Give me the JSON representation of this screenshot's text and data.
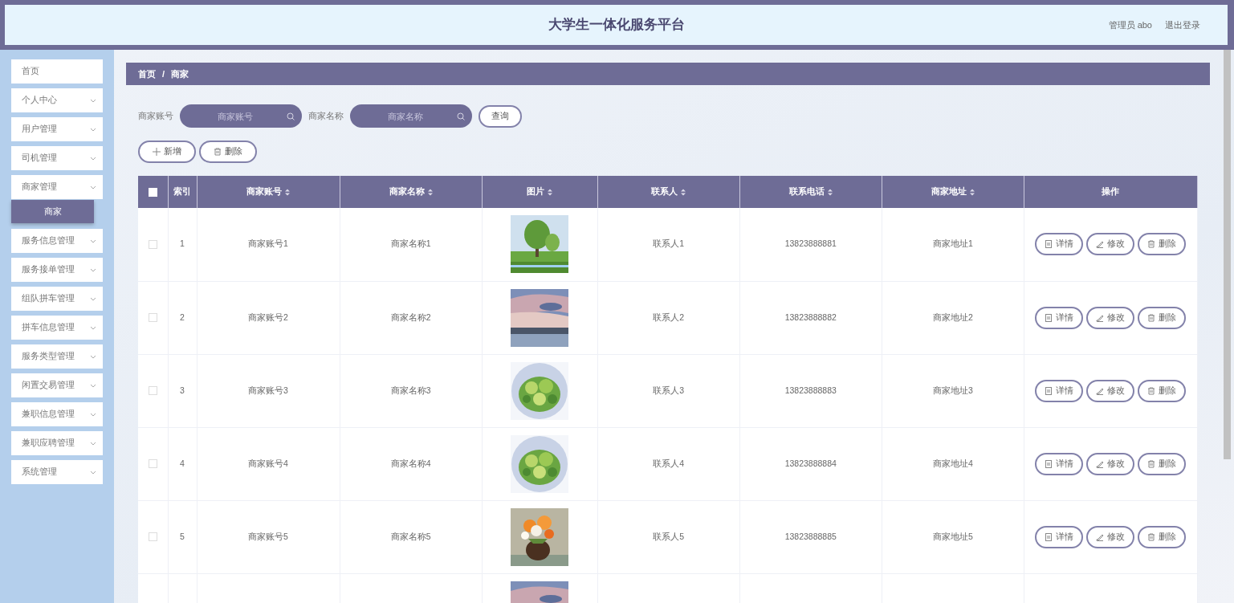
{
  "header": {
    "title": "大学生一体化服务平台",
    "user": "管理员 abo",
    "logout": "退出登录"
  },
  "sidebar": {
    "items": [
      {
        "label": "首页",
        "has_children": false
      },
      {
        "label": "个人中心",
        "has_children": true
      },
      {
        "label": "用户管理",
        "has_children": true
      },
      {
        "label": "司机管理",
        "has_children": true
      },
      {
        "label": "商家管理",
        "has_children": true,
        "children": [
          {
            "label": "商家",
            "selected": true
          }
        ]
      },
      {
        "label": "服务信息管理",
        "has_children": true
      },
      {
        "label": "服务接单管理",
        "has_children": true
      },
      {
        "label": "组队拼车管理",
        "has_children": true
      },
      {
        "label": "拼车信息管理",
        "has_children": true
      },
      {
        "label": "服务类型管理",
        "has_children": true
      },
      {
        "label": "闲置交易管理",
        "has_children": true
      },
      {
        "label": "兼职信息管理",
        "has_children": true
      },
      {
        "label": "兼职应聘管理",
        "has_children": true
      },
      {
        "label": "系统管理",
        "has_children": true
      }
    ]
  },
  "breadcrumb": [
    "首页",
    "商家"
  ],
  "breadcrumb_separator": "/",
  "search": {
    "fields": [
      {
        "label": "商家账号",
        "placeholder": "商家账号"
      },
      {
        "label": "商家名称",
        "placeholder": "商家名称"
      }
    ],
    "button": "查询"
  },
  "actions": [
    {
      "kind": "add",
      "label": "新增"
    },
    {
      "kind": "delete",
      "label": "删除"
    }
  ],
  "table": {
    "columns": [
      {
        "label": "索引",
        "sortable": false
      },
      {
        "label": "商家账号",
        "sortable": true
      },
      {
        "label": "商家名称",
        "sortable": true
      },
      {
        "label": "图片",
        "sortable": true
      },
      {
        "label": "联系人",
        "sortable": true
      },
      {
        "label": "联系电话",
        "sortable": true
      },
      {
        "label": "商家地址",
        "sortable": true
      },
      {
        "label": "操作",
        "sortable": false
      }
    ],
    "header_checked": false,
    "rows": [
      {
        "checked": false,
        "index": "1",
        "account": "商家账号1",
        "name": "商家名称1",
        "image": {
          "kind": "picture"
        },
        "contact": "联系人1",
        "phone": "13823888881",
        "address": "商家地址1",
        "actions": [
          {
            "kind": "detail",
            "label": "详情"
          },
          {
            "kind": "edit",
            "label": "修改"
          },
          {
            "kind": "delete",
            "label": "删除"
          }
        ]
      },
      {
        "checked": false,
        "index": "2",
        "account": "商家账号2",
        "name": "商家名称2",
        "image": {
          "kind": "picture"
        },
        "contact": "联系人2",
        "phone": "13823888882",
        "address": "商家地址2",
        "actions": [
          {
            "kind": "detail",
            "label": "详情"
          },
          {
            "kind": "edit",
            "label": "修改"
          },
          {
            "kind": "delete",
            "label": "删除"
          }
        ]
      },
      {
        "checked": false,
        "index": "3",
        "account": "商家账号3",
        "name": "商家名称3",
        "image": {
          "kind": "picture"
        },
        "contact": "联系人3",
        "phone": "13823888883",
        "address": "商家地址3",
        "actions": [
          {
            "kind": "detail",
            "label": "详情"
          },
          {
            "kind": "edit",
            "label": "修改"
          },
          {
            "kind": "delete",
            "label": "删除"
          }
        ]
      },
      {
        "checked": false,
        "index": "4",
        "account": "商家账号4",
        "name": "商家名称4",
        "image": {
          "kind": "picture"
        },
        "contact": "联系人4",
        "phone": "13823888884",
        "address": "商家地址4",
        "actions": [
          {
            "kind": "detail",
            "label": "详情"
          },
          {
            "kind": "edit",
            "label": "修改"
          },
          {
            "kind": "delete",
            "label": "删除"
          }
        ]
      },
      {
        "checked": false,
        "index": "5",
        "account": "商家账号5",
        "name": "商家名称5",
        "image": {
          "kind": "picture"
        },
        "contact": "联系人5",
        "phone": "13823888885",
        "address": "商家地址5",
        "actions": [
          {
            "kind": "detail",
            "label": "详情"
          },
          {
            "kind": "edit",
            "label": "修改"
          },
          {
            "kind": "delete",
            "label": "删除"
          }
        ]
      },
      {
        "image": {
          "kind": "picture"
        }
      }
    ]
  }
}
